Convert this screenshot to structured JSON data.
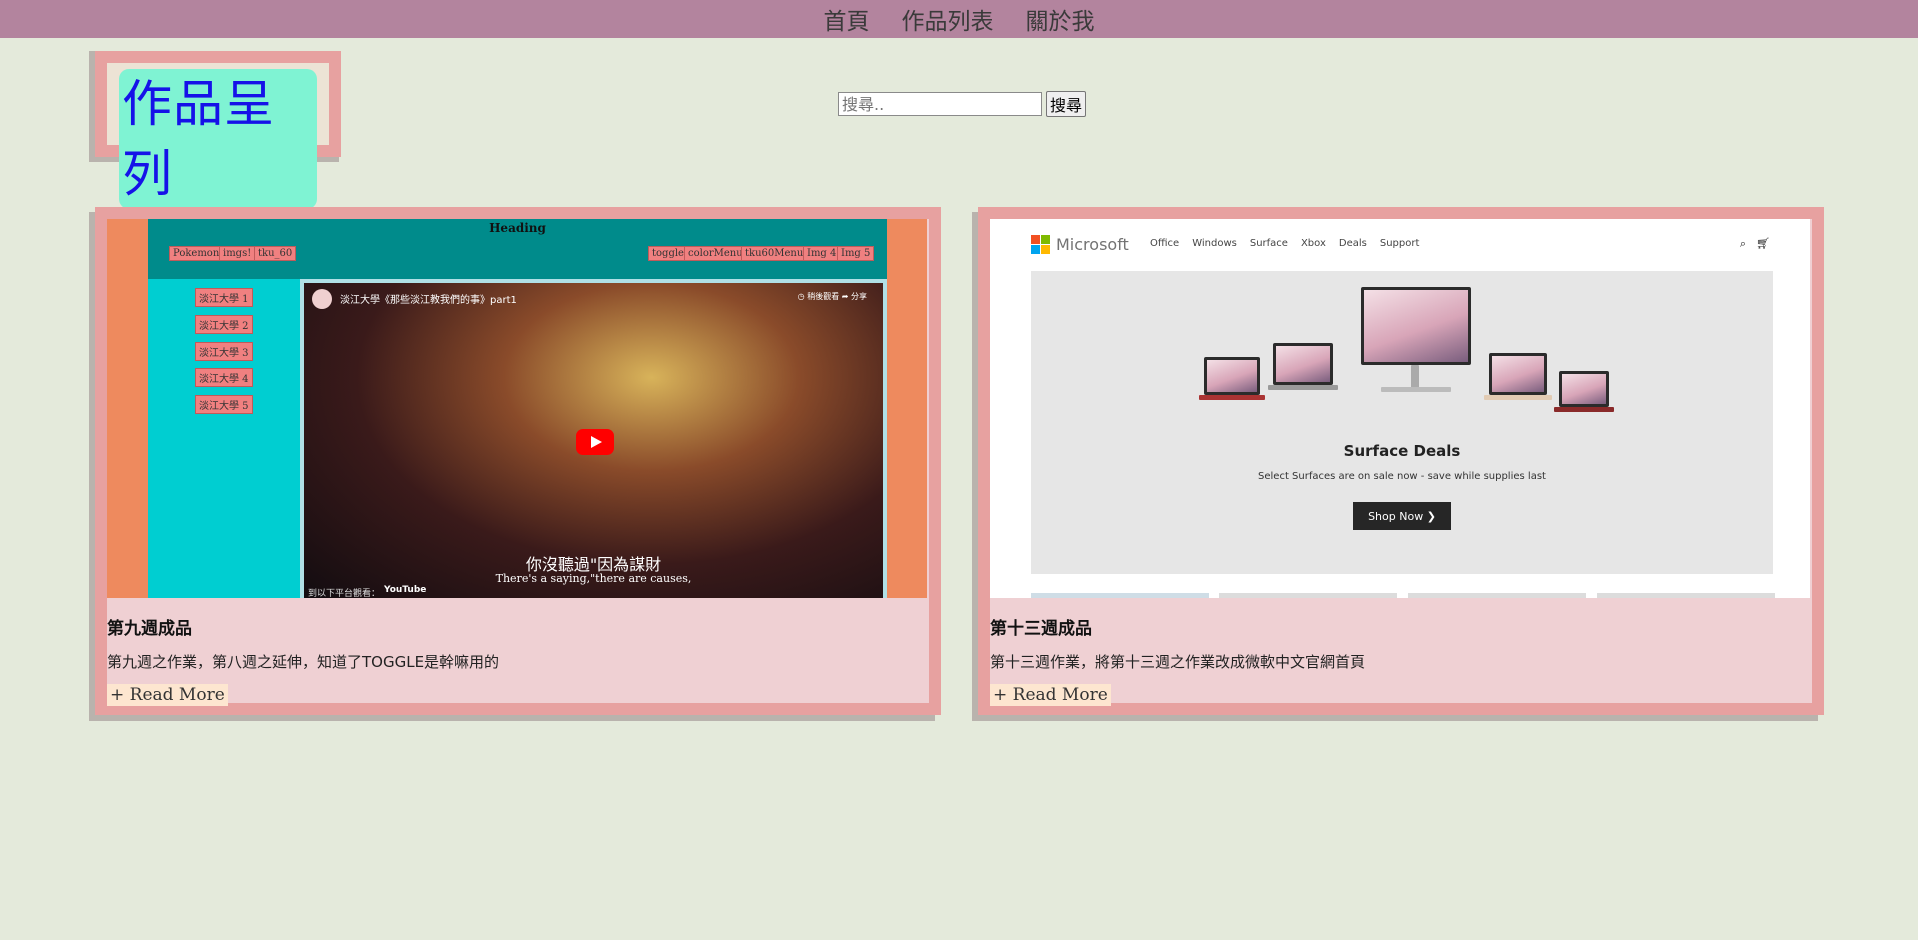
{
  "nav": {
    "items": [
      "首頁",
      "作品列表",
      "關於我"
    ]
  },
  "logo": {
    "title": "作品呈列"
  },
  "search": {
    "placeholder": "搜尋..",
    "button": "搜尋"
  },
  "cards": [
    {
      "title": "第九週成品",
      "desc": "第九週之作業，第八週之延伸，知道了TOGGLE是幹嘛用的",
      "read_more": "+ Read More",
      "thumb": {
        "heading": "Heading",
        "left_tags": [
          "Pokemon",
          "imgs!",
          "tku_60"
        ],
        "right_tags": [
          "toggle",
          "colorMenu",
          "tku60Menu",
          "Img 4",
          "Img 5"
        ],
        "side_items": [
          "淡江大學 1",
          "淡江大學 2",
          "淡江大學 3",
          "淡江大學 4",
          "淡江大學 5"
        ],
        "video_title": "淡江大學《那些淡江教我們的事》part1",
        "video_watch_later": "稍後觀看",
        "video_share": "分享",
        "subtitle_cn": "你沒聽過\"因為謀財",
        "subtitle_en": "There's a saying,\"there are causes,",
        "yt_bar": "到以下平台觀看：",
        "yt_logo": "YouTube"
      }
    },
    {
      "title": "第十三週成品",
      "desc": "第十三週作業，將第十三週之作業改成微軟中文官網首頁",
      "read_more": "+ Read More",
      "thumb": {
        "brand": "Microsoft",
        "nav": [
          "Office",
          "Windows",
          "Surface",
          "Xbox",
          "Deals",
          "Support"
        ],
        "deal_title": "Surface Deals",
        "deal_sub": "Select Surfaces are on sale now - save while supplies last",
        "shop_button": "Shop Now ❯"
      }
    }
  ],
  "colors": {
    "background": "#e4eadb",
    "nav_bar": "#b3849e",
    "frame": "#e7a1a0",
    "card_body": "#efd0d3",
    "logo_text": "#1512e8",
    "logo_bg": "#7ff3d3",
    "read_more_bg": "#fde6d0"
  }
}
